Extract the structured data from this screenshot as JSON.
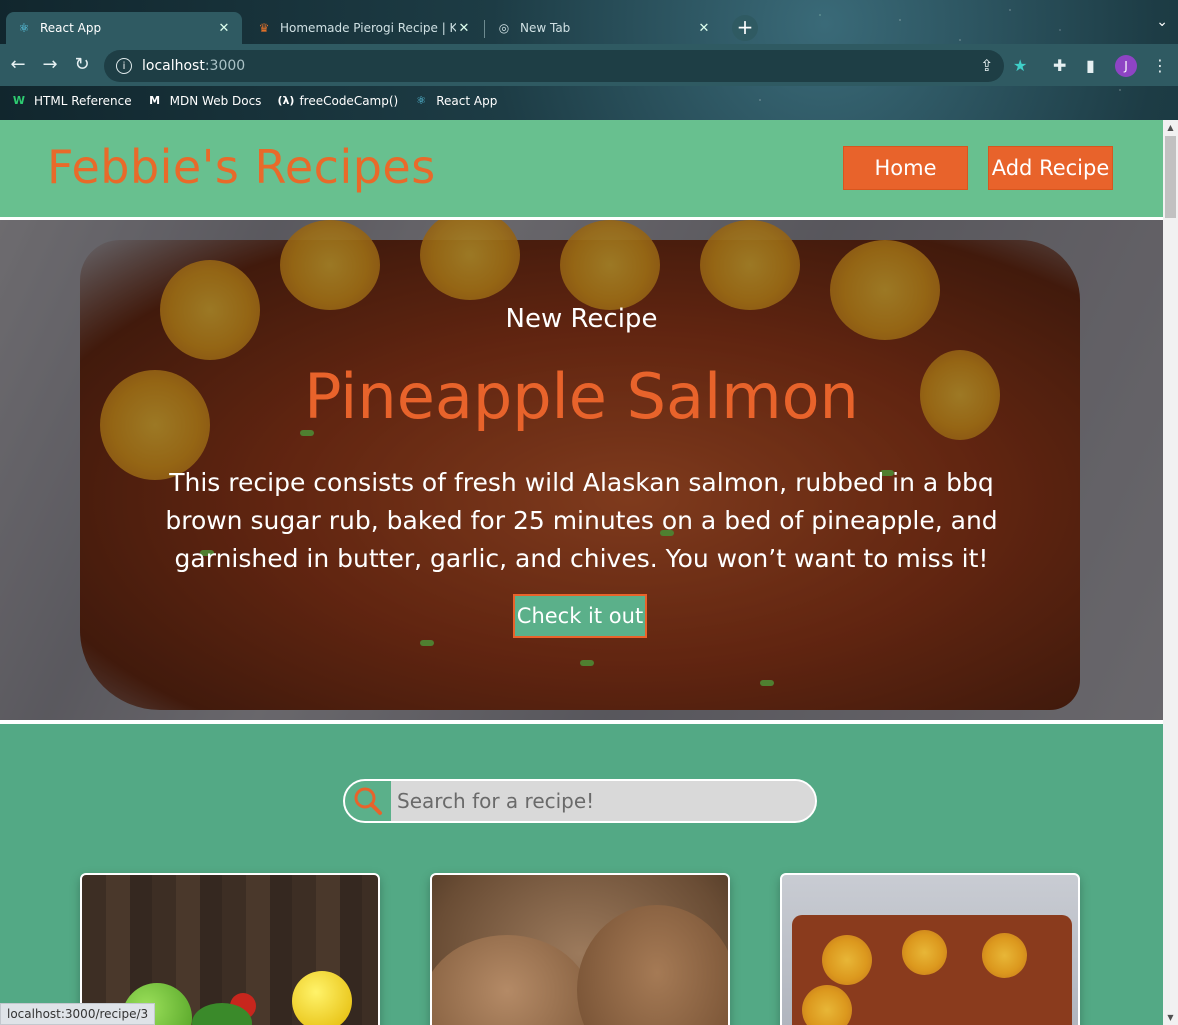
{
  "browser": {
    "tabs": [
      {
        "title": "React App",
        "icon": "react-icon",
        "active": true
      },
      {
        "title": "Homemade Pierogi Recipe | King",
        "icon": "king-arthur-icon",
        "active": false
      },
      {
        "title": "New Tab",
        "icon": "chrome-icon",
        "active": false
      }
    ],
    "url_host": "localhost",
    "url_port": ":3000",
    "profile_initial": "J",
    "bookmarks": [
      {
        "label": "HTML Reference",
        "icon": "w3-icon"
      },
      {
        "label": "MDN Web Docs",
        "icon": "mdn-icon"
      },
      {
        "label": "freeCodeCamp()",
        "icon": "fcc-icon"
      },
      {
        "label": "React App",
        "icon": "react-icon"
      }
    ],
    "status_url": "localhost:3000/recipe/3"
  },
  "site": {
    "brand": "Febbie's Recipes",
    "nav": {
      "home": "Home",
      "add_recipe": "Add Recipe"
    },
    "colors": {
      "accent": "#e8632b",
      "header_bg": "#68c08f",
      "page_bg": "#53a985"
    }
  },
  "hero": {
    "eyebrow": "New Recipe",
    "title": "Pineapple Salmon",
    "description": "This recipe consists of fresh wild Alaskan salmon, rubbed in a bbq brown sugar rub, baked for 25 minutes on a bed of pineapple, and garnished in butter, garlic, and chives. You won’t want to miss it!",
    "cta": "Check it out"
  },
  "search": {
    "placeholder": "Search for a recipe!",
    "value": ""
  }
}
